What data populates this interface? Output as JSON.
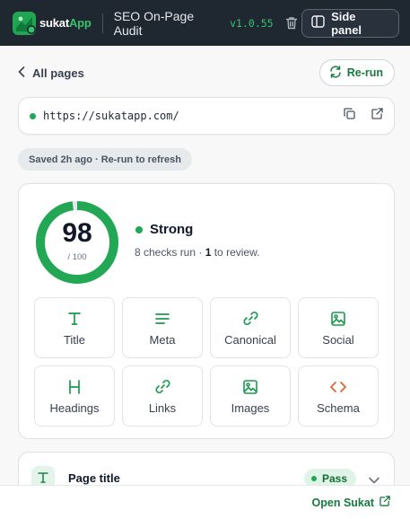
{
  "header": {
    "brand_prefix": "sukat",
    "brand_suffix": "App",
    "title": "SEO On-Page Audit",
    "version": "v1.0.55",
    "side_panel_label": "Side panel"
  },
  "nav": {
    "back_label": "All pages",
    "rerun_label": "Re-run"
  },
  "url_bar": {
    "url": "https://sukatapp.com/"
  },
  "saved_notice": "Saved 2h ago · Re-run to refresh",
  "score": {
    "value": "98",
    "max": "/ 100",
    "fraction": 0.98,
    "status": "Strong",
    "checks_prefix": "8 checks run · ",
    "review_count": "1",
    "checks_suffix": " to review."
  },
  "categories": [
    {
      "label": "Title",
      "icon": "type-icon"
    },
    {
      "label": "Meta",
      "icon": "lines-icon"
    },
    {
      "label": "Canonical",
      "icon": "link-icon"
    },
    {
      "label": "Social",
      "icon": "image-icon"
    },
    {
      "label": "Headings",
      "icon": "heading-icon"
    },
    {
      "label": "Links",
      "icon": "link-icon"
    },
    {
      "label": "Images",
      "icon": "image-icon"
    },
    {
      "label": "Schema",
      "icon": "code-icon"
    }
  ],
  "section": {
    "title": "Page title",
    "badge": "Pass"
  },
  "footer": {
    "open_label": "Open Sukat"
  },
  "colors": {
    "accent": "#22a855",
    "accent_dark": "#167a3e",
    "header_bg": "#1f2731",
    "schema_icon": "#e0672a"
  }
}
